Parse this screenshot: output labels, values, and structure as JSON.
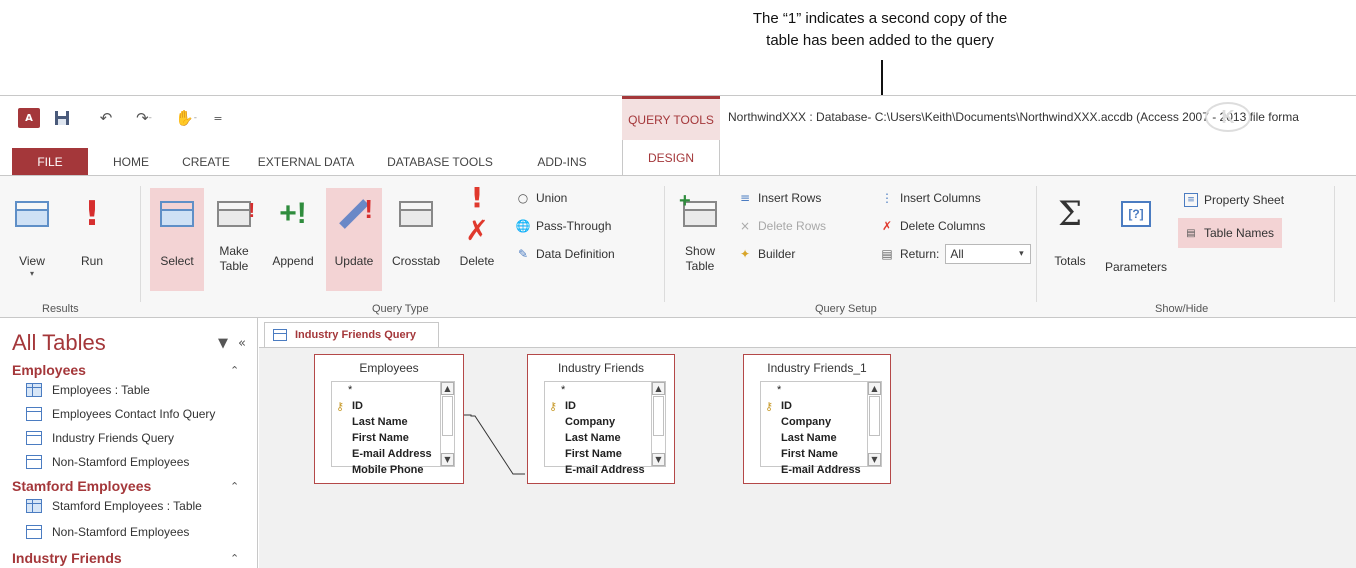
{
  "callout": {
    "line1": "The “1” indicates a second copy of the",
    "line2": "table has been added to the query"
  },
  "qat": {
    "app_icon": "A",
    "save_icon": "save-icon",
    "undo_icon": "undo-icon",
    "redo_icon": "redo-icon",
    "touch_icon": "touch-icon",
    "customize_icon": "customize-icon"
  },
  "contextual_tab": "QUERY TOOLS",
  "window_title": "NorthwindXXX : Database- C:\\Users\\Keith\\Documents\\NorthwindXXX.accdb (Access 2007 - 2013 file forma",
  "tabs": [
    "FILE",
    "HOME",
    "CREATE",
    "EXTERNAL DATA",
    "DATABASE TOOLS",
    "ADD-INS",
    "DESIGN"
  ],
  "ribbon": {
    "results": {
      "title": "Results",
      "view": "View",
      "run": "Run"
    },
    "query_type": {
      "title": "Query Type",
      "select": "Select",
      "make_table_1": "Make",
      "make_table_2": "Table",
      "append": "Append",
      "update": "Update",
      "crosstab": "Crosstab",
      "delete": "Delete",
      "union": "Union",
      "pass_through": "Pass-Through",
      "data_definition": "Data Definition"
    },
    "query_setup": {
      "title": "Query Setup",
      "show_table_1": "Show",
      "show_table_2": "Table",
      "insert_rows": "Insert Rows",
      "delete_rows": "Delete Rows",
      "builder": "Builder",
      "insert_columns": "Insert Columns",
      "delete_columns": "Delete Columns",
      "return_label": "Return:",
      "return_value": "All"
    },
    "show_hide": {
      "title": "Show/Hide",
      "totals": "Totals",
      "parameters": "Parameters",
      "property_sheet": "Property Sheet",
      "table_names": "Table Names"
    }
  },
  "nav": {
    "title": "All Tables",
    "groups": [
      {
        "name": "Employees",
        "items": [
          {
            "label": "Employees : Table",
            "icon": "table"
          },
          {
            "label": "Employees Contact Info Query",
            "icon": "query"
          },
          {
            "label": "Industry Friends Query",
            "icon": "query"
          },
          {
            "label": "Non-Stamford Employees",
            "icon": "query"
          }
        ]
      },
      {
        "name": "Stamford Employees",
        "items": [
          {
            "label": "Stamford Employees : Table",
            "icon": "table"
          },
          {
            "label": "Non-Stamford Employees",
            "icon": "query"
          }
        ]
      },
      {
        "name": "Industry Friends",
        "items": []
      }
    ]
  },
  "doc_tab": "Industry Friends Query",
  "field_lists": [
    {
      "title": "Employees",
      "fields": [
        "*",
        "ID",
        "Last Name",
        "First Name",
        "E-mail Address",
        "Mobile Phone"
      ]
    },
    {
      "title": "Industry Friends",
      "fields": [
        "*",
        "ID",
        "Company",
        "Last Name",
        "First Name",
        "E-mail Address"
      ]
    },
    {
      "title": "Industry Friends_1",
      "fields": [
        "*",
        "ID",
        "Company",
        "Last Name",
        "First Name",
        "E-mail Address"
      ]
    }
  ],
  "colors": {
    "accent": "#a4373a",
    "highlight": "#f3d3d4",
    "canvas": "#f1f1f1"
  }
}
